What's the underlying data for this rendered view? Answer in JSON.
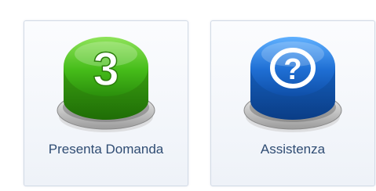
{
  "tiles": [
    {
      "label": "Presenta Domanda",
      "icon": "number-three-button-icon",
      "glyph": "3",
      "color": "#3fb81c"
    },
    {
      "label": "Assistenza",
      "icon": "help-question-button-icon",
      "glyph": "?",
      "color": "#1f6fd4"
    }
  ]
}
